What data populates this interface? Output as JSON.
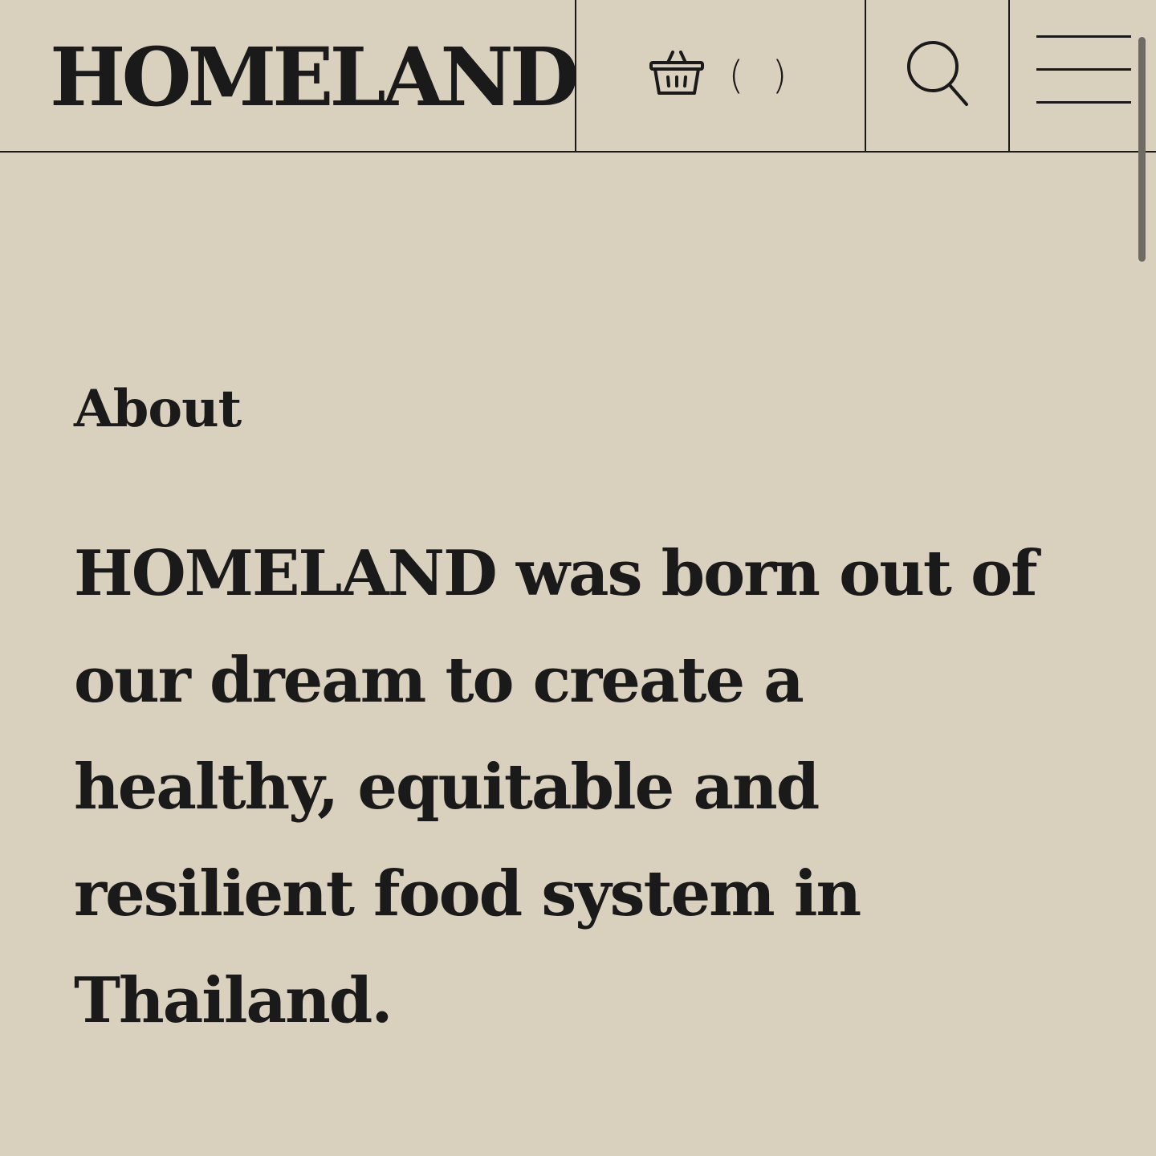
{
  "header": {
    "logo": "HOMELAND",
    "cart_count": "( )",
    "icons": {
      "cart": "basket-icon",
      "search": "search-icon",
      "menu": "hamburger-menu-icon"
    }
  },
  "about": {
    "label": "About",
    "text": "HOMELAND was born out of our dream to create a healthy, equitable and resilient food system in Thailand."
  },
  "colors": {
    "background": "#d9d0be",
    "text": "#1a1a1a"
  }
}
